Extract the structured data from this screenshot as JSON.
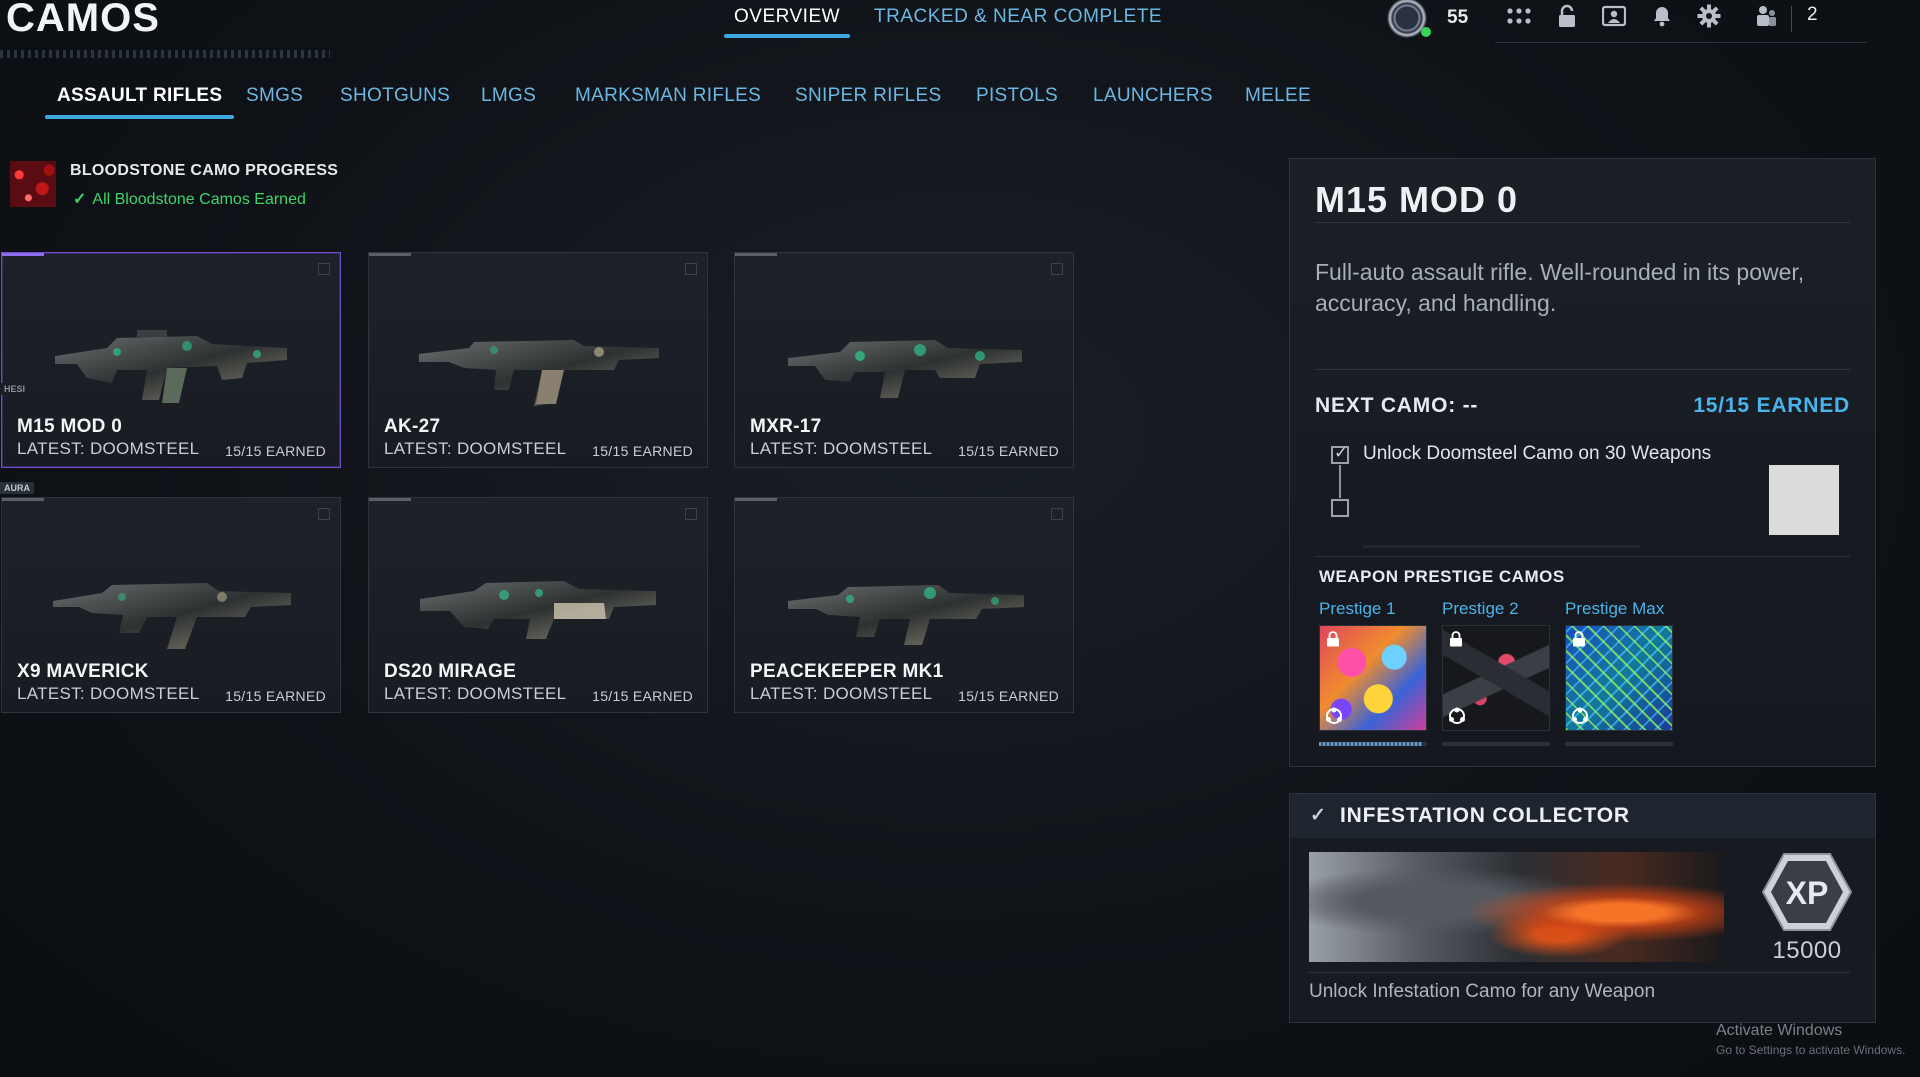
{
  "header": {
    "title": "CAMOS",
    "tabs": [
      {
        "label": "OVERVIEW",
        "active": true
      },
      {
        "label": "TRACKED & NEAR COMPLETE",
        "active": false
      }
    ],
    "rank": "55",
    "party_count": "2",
    "icons": [
      "rank-emblem-icon",
      "grid-menu-icon",
      "lock-icon",
      "id-card-icon",
      "bell-icon",
      "gear-icon",
      "party-icon"
    ]
  },
  "categories": [
    {
      "label": "ASSAULT RIFLES",
      "active": true
    },
    {
      "label": "SMGS"
    },
    {
      "label": "SHOTGUNS"
    },
    {
      "label": "LMGS"
    },
    {
      "label": "MARKSMAN RIFLES"
    },
    {
      "label": "SNIPER RIFLES"
    },
    {
      "label": "PISTOLS"
    },
    {
      "label": "LAUNCHERS"
    },
    {
      "label": "MELEE"
    }
  ],
  "bloodstone": {
    "title": "BLOODSTONE CAMO PROGRESS",
    "status": "All Bloodstone Camos Earned"
  },
  "weapons": [
    {
      "name": "M15 MOD 0",
      "latest": "LATEST: DOOMSTEEL",
      "earned": "15/15 EARNED",
      "selected": true
    },
    {
      "name": "AK-27",
      "latest": "LATEST: DOOMSTEEL",
      "earned": "15/15 EARNED"
    },
    {
      "name": "MXR-17",
      "latest": "LATEST: DOOMSTEEL",
      "earned": "15/15 EARNED"
    },
    {
      "name": "X9 MAVERICK",
      "latest": "LATEST: DOOMSTEEL",
      "earned": "15/15 EARNED"
    },
    {
      "name": "DS20 MIRAGE",
      "latest": "LATEST: DOOMSTEEL",
      "earned": "15/15 EARNED"
    },
    {
      "name": "PEACEKEEPER MK1",
      "latest": "LATEST: DOOMSTEEL",
      "earned": "15/15 EARNED"
    }
  ],
  "side_tags": [
    "HESI",
    "AURA"
  ],
  "detail": {
    "weapon_name": "M15 MOD 0",
    "description": "Full-auto assault rifle. Well-rounded in its power, accuracy, and handling.",
    "next_camo": "NEXT CAMO: --",
    "earned": "15/15 EARNED",
    "challenge": "Unlock Doomsteel Camo on 30 Weapons",
    "challenge_checked": true,
    "prestige_heading": "WEAPON PRESTIGE CAMOS",
    "prestige": [
      {
        "label": "Prestige 1",
        "locked": true,
        "progress": 0.95
      },
      {
        "label": "Prestige 2",
        "locked": true,
        "progress": 0
      },
      {
        "label": "Prestige Max",
        "locked": true,
        "progress": 0
      }
    ]
  },
  "collector": {
    "title": "INFESTATION COLLECTOR",
    "completed": true,
    "xp_label": "XP",
    "xp_amount": "15000",
    "description": "Unlock Infestation Camo for any Weapon"
  },
  "watermark": {
    "title": "Activate Windows",
    "subtitle": "Go to Settings to activate Windows."
  },
  "colors": {
    "accent_blue": "#3fa8e0",
    "link_blue": "#6cb7e3",
    "earned_blue": "#4ab3ea",
    "success_green": "#3fd46a",
    "selected_purple": "#6f4fc7"
  }
}
